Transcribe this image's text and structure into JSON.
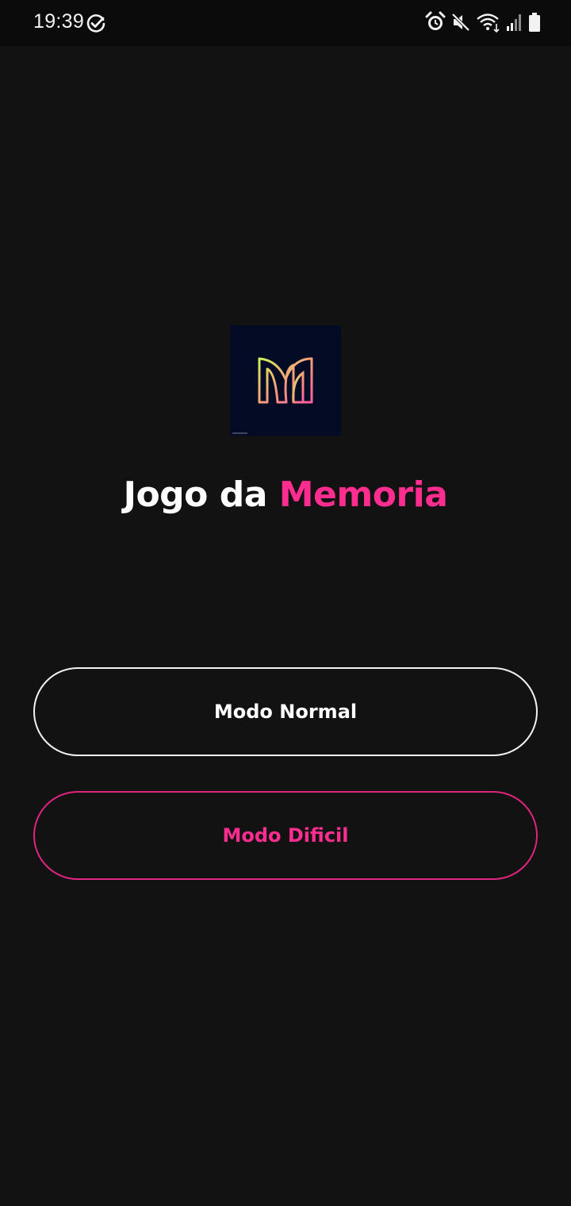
{
  "status_bar": {
    "time": "19:39",
    "icons": [
      "task-done-icon",
      "alarm-icon",
      "mute-icon",
      "wifi-icon",
      "signal-icon",
      "battery-icon"
    ]
  },
  "app": {
    "title_part1": "Jogo da ",
    "title_part2": "Memoria"
  },
  "buttons": {
    "normal": "Modo Normal",
    "hard": "Modo Dificil"
  },
  "colors": {
    "background": "#121212",
    "accent": "#ff2d8f",
    "logo_background": "#040b25"
  }
}
